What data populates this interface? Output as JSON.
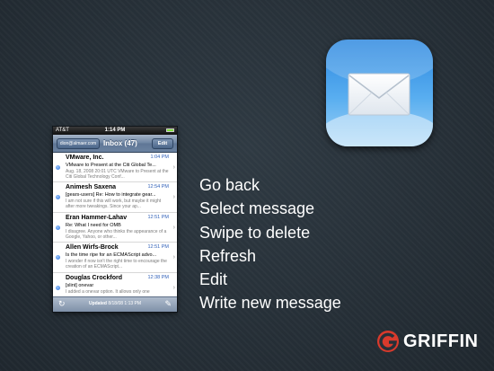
{
  "phone": {
    "status": {
      "carrier": "AT&T",
      "clock": "1:14 PM"
    },
    "nav": {
      "back_label": "dion@almaer.com",
      "title": "Inbox (47)",
      "edit_label": "Edit"
    },
    "messages": [
      {
        "sender": "VMware, Inc.",
        "time": "1:04 PM",
        "subject": "VMware to Present at the Citi Global Te...",
        "preview": "Aug. 18, 2008 20:01 UTC VMware to Present at the Citi Global Technology Conf..."
      },
      {
        "sender": "Animesh Saxena",
        "time": "12:54 PM",
        "subject": "[gears-users] Re: How to integrate gear...",
        "preview": "I am not sure if this will work, but maybe it might after more tweakings. Since your ap..."
      },
      {
        "sender": "Eran Hammer-Lahav",
        "time": "12:51 PM",
        "subject": "Re: What I need for OMB",
        "preview": "I disagree. Anyone who thinks the appearance of a Google, Yahoo, or other..."
      },
      {
        "sender": "Allen Wirfs-Brock",
        "time": "12:51 PM",
        "subject": "Is the time ripe for an ECMAScript advo...",
        "preview": "I wonder if now isn't the right time to encourage the creation of an ECMAScript..."
      },
      {
        "sender": "Douglas Crockford",
        "time": "12:38 PM",
        "subject": "[slint] onevar",
        "preview": "I added a onevar option. It allows only one"
      }
    ],
    "toolbar": {
      "updated_label": "Updated",
      "updated_value": "8/18/08 1:13 PM"
    }
  },
  "legend": [
    "Go back",
    "Select message",
    "Swipe to delete",
    "Refresh",
    "Edit",
    "Write new message"
  ],
  "brand": {
    "name": "GRIFFIN"
  },
  "colors": {
    "accent": "#d83a2c",
    "nav_blue": "#6d84a2",
    "unread_dot": "#2c6fd6",
    "time_blue": "#2e5fb8"
  }
}
